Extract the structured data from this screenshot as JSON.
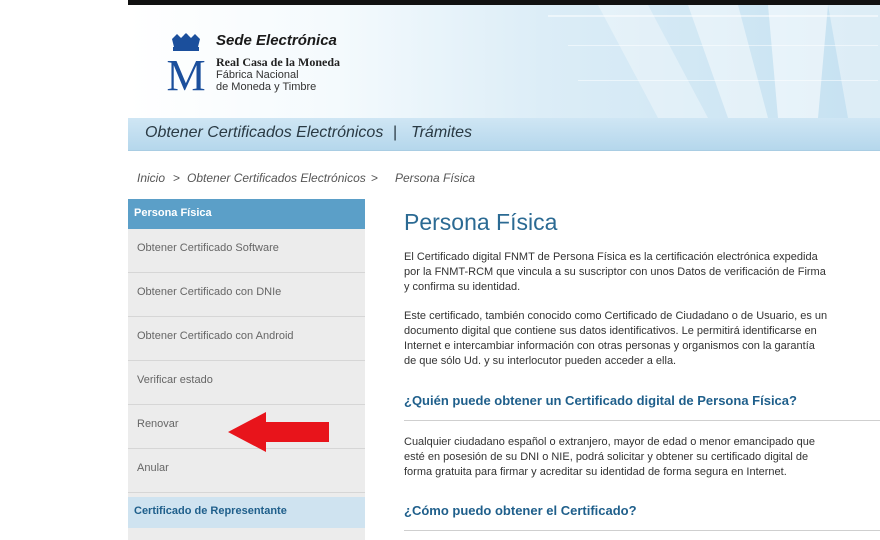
{
  "header": {
    "site_title": "Sede Electrónica",
    "org_name": "Real Casa de la Moneda",
    "org_sub_1": "Fábrica Nacional",
    "org_sub_2": "de Moneda y Timbre",
    "logo_letter": "M"
  },
  "nav": {
    "item_1": "Obtener Certificados Electrónicos",
    "separator": "|",
    "item_2": "Trámites"
  },
  "breadcrumb": {
    "home": "Inicio",
    "level_1": "Obtener Certificados Electrónicos",
    "current": "Persona Física",
    "separator": ">"
  },
  "sidebar": {
    "section_title": "Persona Física",
    "items": [
      {
        "label": "Obtener Certificado Software"
      },
      {
        "label": "Obtener Certificado con DNIe"
      },
      {
        "label": "Obtener Certificado con Android"
      },
      {
        "label": "Verificar estado"
      },
      {
        "label": "Renovar"
      },
      {
        "label": "Anular"
      }
    ],
    "section_2_title": "Certificado de Representante"
  },
  "main": {
    "title": "Persona Física",
    "intro_lines": [
      "El Certificado digital FNMT de Persona Física es la certificación electrónica expedida",
      "por la FNMT-RCM que vincula a su suscriptor con unos Datos de verificación de Firma",
      "y confirma su identidad."
    ],
    "para2_lines": [
      "Este certificado, también conocido como Certificado de Ciudadano o de Usuario, es un",
      "documento digital que contiene sus datos identificativos. Le permitirá identificarse en",
      "Internet e intercambiar información con otras personas y organismos con la garantía",
      "de que sólo Ud. y su interlocutor pueden acceder a ella."
    ],
    "q1": "¿Quién puede obtener un Certificado digital de Persona Física?",
    "q1_lines": [
      "Cualquier ciudadano español o extranjero, mayor de edad o menor emancipado que",
      "esté en posesión de su DNI o NIE, podrá solicitar y obtener su certificado digital de",
      "forma gratuita para firmar y acreditar su identidad de forma segura en Internet."
    ],
    "q2": "¿Cómo puedo obtener el Certificado?"
  },
  "colors": {
    "accent": "#2b6a93",
    "sidebar_header": "#5b9fc8",
    "annotation_arrow": "#e8141b"
  },
  "icons": {
    "logo": "crown-m-logo-icon",
    "annotation": "red-arrow-icon"
  }
}
